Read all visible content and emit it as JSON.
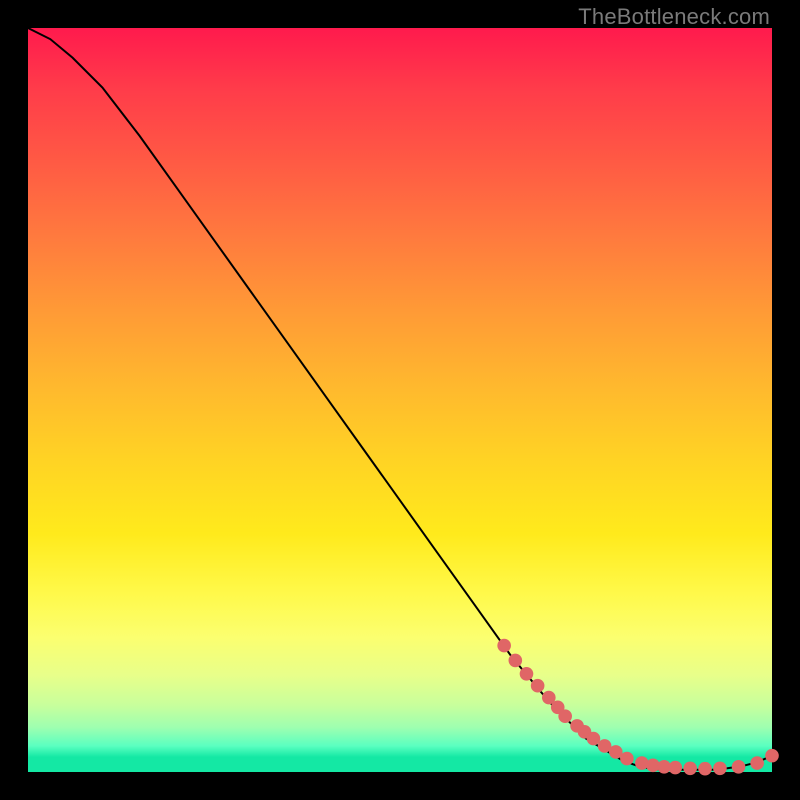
{
  "watermark": "TheBottleneck.com",
  "chart_data": {
    "type": "line",
    "title": "",
    "xlabel": "",
    "ylabel": "",
    "xlim": [
      0,
      100
    ],
    "ylim": [
      0,
      100
    ],
    "series": [
      {
        "name": "curve",
        "x": [
          0,
          3,
          6,
          10,
          15,
          20,
          25,
          30,
          35,
          40,
          45,
          50,
          55,
          60,
          65,
          70,
          75,
          80,
          82,
          84,
          86,
          88,
          90,
          92,
          94,
          96,
          98,
          100
        ],
        "y": [
          100,
          98.5,
          96,
          92,
          85.5,
          78.5,
          71.5,
          64.5,
          57.5,
          50.5,
          43.5,
          36.5,
          29.5,
          22.5,
          15.5,
          9.5,
          4.5,
          1.5,
          0.8,
          0.4,
          0.3,
          0.3,
          0.3,
          0.3,
          0.5,
          0.8,
          1.3,
          2.2
        ]
      }
    ],
    "scatter": {
      "name": "points",
      "x": [
        64,
        65.5,
        67,
        68.5,
        70,
        71.2,
        72.2,
        73.8,
        74.8,
        76,
        77.5,
        79,
        80.5,
        82.5,
        84,
        85.5,
        87,
        89,
        91,
        93,
        95.5,
        98,
        100
      ],
      "y": [
        17,
        15,
        13.2,
        11.6,
        10,
        8.7,
        7.5,
        6.2,
        5.4,
        4.5,
        3.5,
        2.7,
        1.8,
        1.2,
        0.9,
        0.7,
        0.6,
        0.5,
        0.45,
        0.5,
        0.7,
        1.2,
        2.2
      ]
    },
    "colors": {
      "curve": "#000000",
      "points": "#e06666",
      "gradient_top": "#ff1a4d",
      "gradient_bottom": "#14e8a4"
    }
  }
}
